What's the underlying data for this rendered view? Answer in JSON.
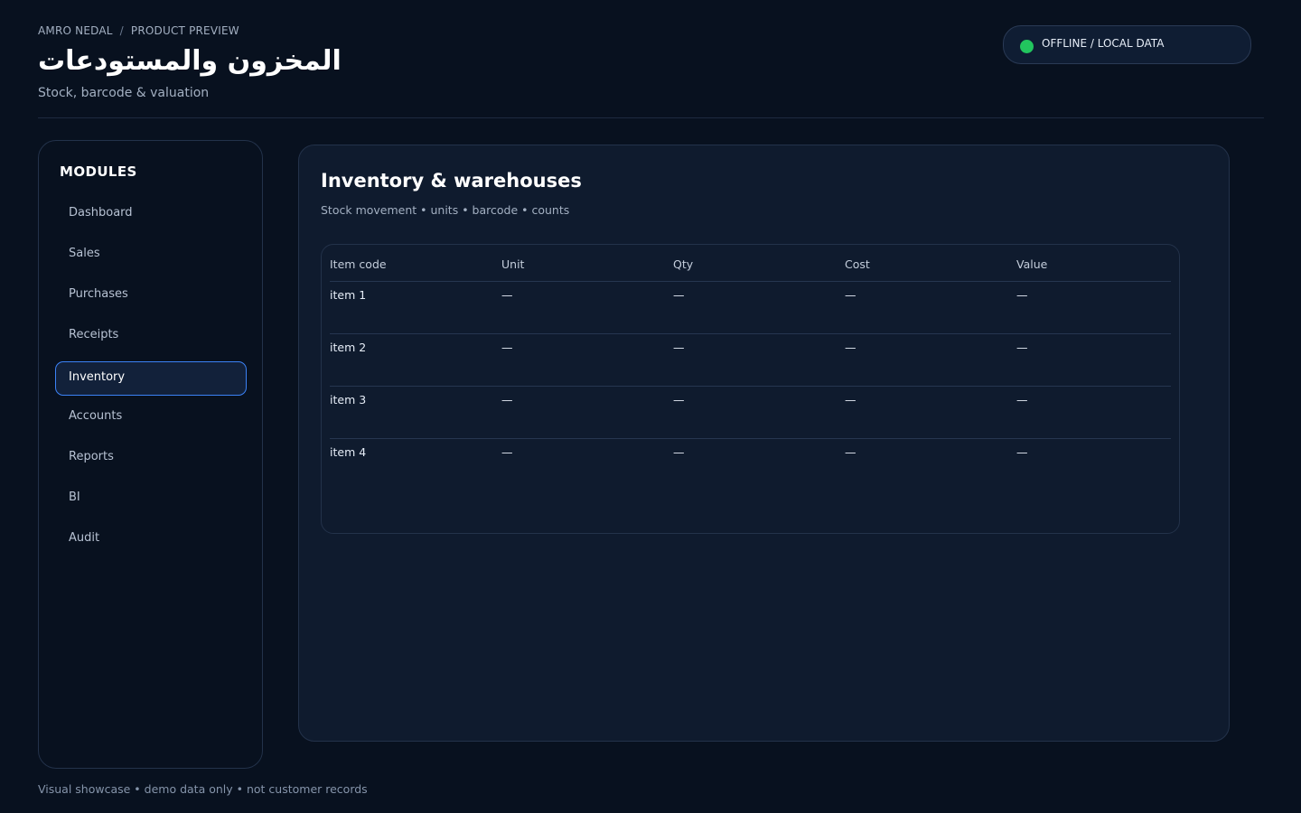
{
  "header": {
    "breadcrumb": [
      "AMRO NEDAL",
      "PRODUCT PREVIEW"
    ],
    "breadcrumb_separator": "/",
    "title": "المخزون والمستودعات",
    "subtitle": "Stock, barcode & valuation"
  },
  "status": {
    "label": "OFFLINE / LOCAL DATA",
    "color": "#22c55e"
  },
  "sidebar": {
    "title": "MODULES",
    "items": [
      {
        "label": "Dashboard",
        "active": false
      },
      {
        "label": "Sales",
        "active": false
      },
      {
        "label": "Purchases",
        "active": false
      },
      {
        "label": "Receipts",
        "active": false
      },
      {
        "label": "Inventory",
        "active": true
      },
      {
        "label": "Accounts",
        "active": false
      },
      {
        "label": "Reports",
        "active": false
      },
      {
        "label": "BI",
        "active": false
      },
      {
        "label": "Audit",
        "active": false
      }
    ]
  },
  "main": {
    "title": "Inventory & warehouses",
    "subtitle": "Stock movement • units • barcode • counts",
    "table": {
      "columns": [
        "Item code",
        "Unit",
        "Qty",
        "Cost",
        "Value"
      ],
      "rows": [
        [
          "item 1",
          "—",
          "—",
          "—",
          "—"
        ],
        [
          "item 2",
          "—",
          "—",
          "—",
          "—"
        ],
        [
          "item 3",
          "—",
          "—",
          "—",
          "—"
        ],
        [
          "item 4",
          "—",
          "—",
          "—",
          "—"
        ]
      ]
    }
  },
  "footer": {
    "text": "Visual showcase • demo data only • not customer records"
  },
  "colors": {
    "background": "#08111f",
    "panel": "#0f1b2e",
    "accent": "#3b82f6",
    "status_online": "#22c55e"
  }
}
